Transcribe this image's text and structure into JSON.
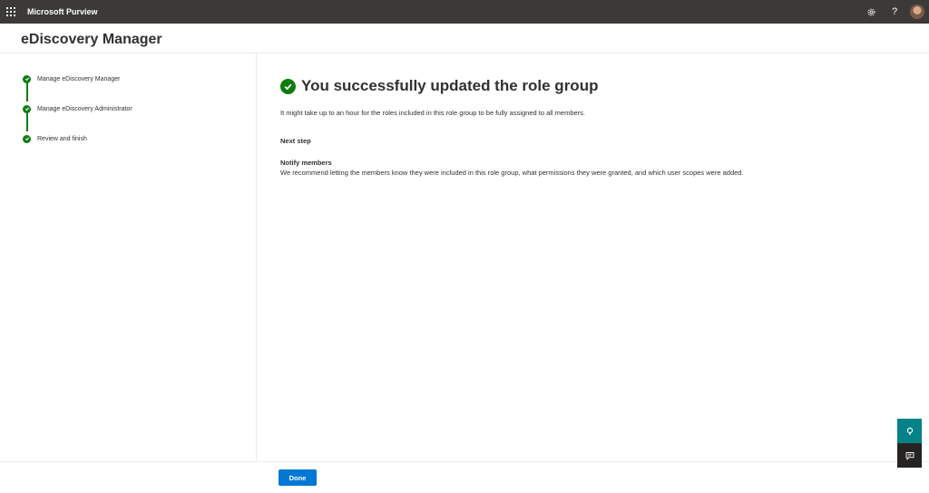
{
  "topbar": {
    "app_name": "Microsoft Purview",
    "settings_icon": "gear-icon",
    "help_label": "?",
    "waffle_icon": "app-launcher-icon"
  },
  "page": {
    "title": "eDiscovery Manager"
  },
  "steps": [
    {
      "label": "Manage eDiscovery Manager",
      "status": "complete"
    },
    {
      "label": "Manage eDiscovery Administrator",
      "status": "complete"
    },
    {
      "label": "Review and finish",
      "status": "complete"
    }
  ],
  "main": {
    "success_title": "You successfully updated the role group",
    "description": "It might take up to an hour for the roles included in this role group to be fully assigned to all members.",
    "next_step_heading": "Next step",
    "notify_title": "Notify members",
    "notify_body": "We recommend letting the members know they were included in this role group, what permissions they were granted, and which user scopes were added."
  },
  "footer": {
    "done_label": "Done"
  },
  "colors": {
    "topbar_bg": "#3b3a39",
    "success_green": "#107c10",
    "primary_blue": "#0078d4",
    "help_teal": "#038387",
    "feedback_dark": "#252423"
  }
}
